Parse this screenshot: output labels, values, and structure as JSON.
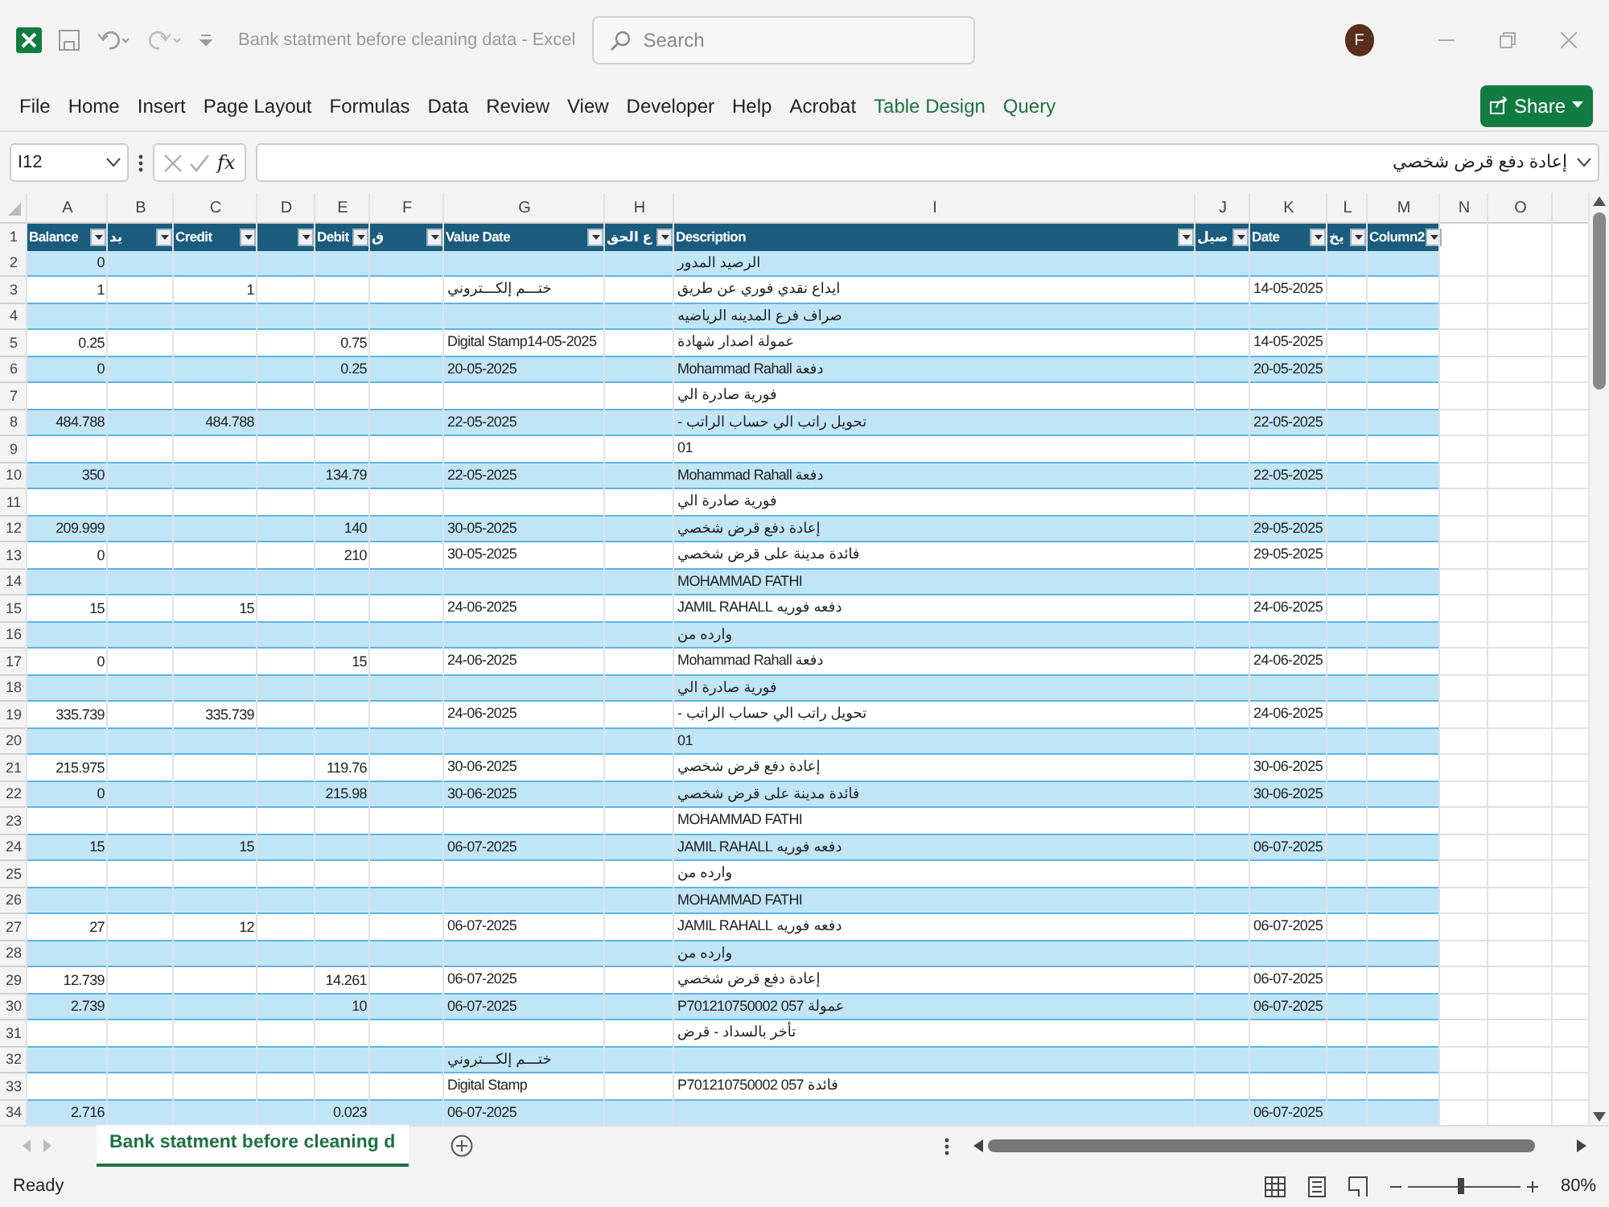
{
  "window": {
    "title": "Bank statment before cleaning data  -  Excel",
    "user_initial": "F"
  },
  "search": {
    "placeholder": "Search"
  },
  "ribbon_tabs": [
    {
      "label": "File",
      "kind": "normal"
    },
    {
      "label": "Home",
      "kind": "normal"
    },
    {
      "label": "Insert",
      "kind": "normal"
    },
    {
      "label": "Page Layout",
      "kind": "normal"
    },
    {
      "label": "Formulas",
      "kind": "normal"
    },
    {
      "label": "Data",
      "kind": "normal"
    },
    {
      "label": "Review",
      "kind": "normal"
    },
    {
      "label": "View",
      "kind": "normal"
    },
    {
      "label": "Developer",
      "kind": "normal"
    },
    {
      "label": "Help",
      "kind": "normal"
    },
    {
      "label": "Acrobat",
      "kind": "normal"
    },
    {
      "label": "Table Design",
      "kind": "contextual"
    },
    {
      "label": "Query",
      "kind": "contextual"
    }
  ],
  "share_button": {
    "label": "Share"
  },
  "formula_bar": {
    "name_box": "I12",
    "function_label": "fx",
    "formula": "إعادة دفع قرض شخصي"
  },
  "column_letters": [
    "A",
    "B",
    "C",
    "D",
    "E",
    "F",
    "G",
    "H",
    "I",
    "J",
    "K",
    "L",
    "M",
    "N",
    "O"
  ],
  "table": {
    "header_row_number": "1",
    "headers": [
      {
        "label": "Balance",
        "filter_button": true
      },
      {
        "label": "يد",
        "filter_button": true
      },
      {
        "label": "Credit",
        "filter_button": true
      },
      {
        "filter_button": true
      },
      {
        "label": "Debit",
        "filter_button": true
      },
      {
        "label": "ق",
        "filter_button": true
      },
      {
        "label": "Value Date",
        "filter_button": true
      },
      {
        "label": "ع الحق",
        "filter_button": true
      },
      {
        "label": "Description",
        "filter_button": true
      },
      {
        "label": "صيل",
        "filter_button": true
      },
      {
        "label": "Date",
        "filter_button": true
      },
      {
        "label": "يخ",
        "filter_button": true
      },
      {
        "label": "Column2",
        "filter_button": true
      }
    ],
    "rows": [
      {
        "number": "2",
        "balance": "0",
        "description": "الرصيد المدور"
      },
      {
        "number": "3",
        "balance": "1",
        "credit": "1",
        "value_date": "ختـــم إلكـــتروني",
        "description": "ايداع نقدي فوري عن طريق",
        "date": "14-05-2025"
      },
      {
        "number": "4",
        "description": "صراف فرع المدينه الرياضيه"
      },
      {
        "number": "5",
        "balance": "0.25",
        "debit": "0.75",
        "value_date": "Digital Stamp14-05-2025",
        "description": "عمولة اصدار شهادة",
        "date": "14-05-2025"
      },
      {
        "number": "6",
        "balance": "0",
        "debit": "0.25",
        "value_date": "20-05-2025",
        "description": "Mohammad Rahall دفعة",
        "date": "20-05-2025"
      },
      {
        "number": "7",
        "description": "فورية صادرة الي"
      },
      {
        "number": "8",
        "balance": "484.788",
        "credit": "484.788",
        "value_date": "22-05-2025",
        "description": "تحويل راتب الي حساب الراتب -",
        "date": "22-05-2025"
      },
      {
        "number": "9",
        "description": "01"
      },
      {
        "number": "10",
        "balance": "350",
        "debit": "134.79",
        "value_date": "22-05-2025",
        "description": "Mohammad Rahall دفعة",
        "date": "22-05-2025"
      },
      {
        "number": "11",
        "description": "فورية صادرة الي"
      },
      {
        "number": "12",
        "balance": "209.999",
        "debit": "140",
        "value_date": "30-05-2025",
        "description": "إعادة دفع قرض شخصي",
        "date": "29-05-2025"
      },
      {
        "number": "13",
        "balance": "0",
        "debit": "210",
        "value_date": "30-05-2025",
        "description": "فائدة مدينة على قرض شخصي",
        "date": "29-05-2025"
      },
      {
        "number": "14",
        "description": "MOHAMMAD FATHI"
      },
      {
        "number": "15",
        "balance": "15",
        "credit": "15",
        "value_date": "24-06-2025",
        "description": "دفعه فوريه JAMIL RAHALL",
        "date": "24-06-2025"
      },
      {
        "number": "16",
        "description": "وارده من"
      },
      {
        "number": "17",
        "balance": "0",
        "debit": "15",
        "value_date": "24-06-2025",
        "description": "Mohammad Rahall دفعة",
        "date": "24-06-2025"
      },
      {
        "number": "18",
        "description": "فورية صادرة الي"
      },
      {
        "number": "19",
        "balance": "335.739",
        "credit": "335.739",
        "value_date": "24-06-2025",
        "description": "تحويل راتب الي حساب الراتب -",
        "date": "24-06-2025"
      },
      {
        "number": "20",
        "description": "01"
      },
      {
        "number": "21",
        "balance": "215.975",
        "debit": "119.76",
        "value_date": "30-06-2025",
        "description": "إعادة دفع قرض شخصي",
        "date": "30-06-2025"
      },
      {
        "number": "22",
        "balance": "0",
        "debit": "215.98",
        "value_date": "30-06-2025",
        "description": "فائدة مدينة على قرض شخصي",
        "date": "30-06-2025"
      },
      {
        "number": "23",
        "description": "MOHAMMAD FATHI"
      },
      {
        "number": "24",
        "balance": "15",
        "credit": "15",
        "value_date": "06-07-2025",
        "description": "دفعه فوريه JAMIL RAHALL",
        "date": "06-07-2025"
      },
      {
        "number": "25",
        "description": "وارده من"
      },
      {
        "number": "26",
        "description": "MOHAMMAD FATHI"
      },
      {
        "number": "27",
        "balance": "27",
        "credit": "12",
        "value_date": "06-07-2025",
        "description": "دفعه فوريه JAMIL RAHALL",
        "date": "06-07-2025"
      },
      {
        "number": "28",
        "description": "وارده من"
      },
      {
        "number": "29",
        "balance": "12.739",
        "debit": "14.261",
        "value_date": "06-07-2025",
        "description": "إعادة دفع قرض شخصي",
        "date": "06-07-2025"
      },
      {
        "number": "30",
        "balance": "2.739",
        "debit": "10",
        "value_date": "06-07-2025",
        "description": "عمولة P701210750002 057",
        "date": "06-07-2025"
      },
      {
        "number": "31",
        "description": "تأخر بالسداد - قرض"
      },
      {
        "number": "32",
        "value_date": "ختـــم إلكـــتروني"
      },
      {
        "number": "33",
        "value_date": "Digital Stamp",
        "description": "فائدة P701210750002 057"
      },
      {
        "number": "34",
        "balance": "2.716",
        "debit": "0.023",
        "value_date": "06-07-2025",
        "date": "06-07-2025"
      }
    ]
  },
  "sheet_tabs": [
    {
      "label": "Bank statment before cleaning d",
      "selected": true
    }
  ],
  "status_bar": {
    "text": "Ready"
  },
  "zoom": {
    "label": "80%",
    "level": 0.47
  }
}
